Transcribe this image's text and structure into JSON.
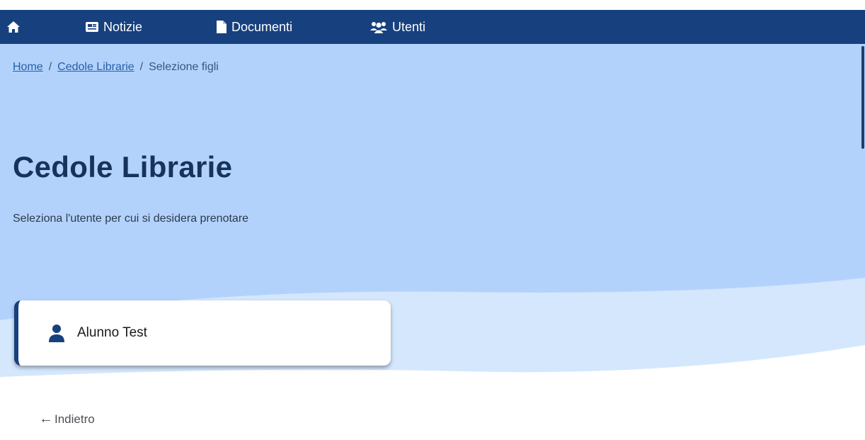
{
  "nav": {
    "home_icon": "home-icon",
    "items": [
      {
        "label": "Notizie",
        "icon": "newspaper-icon"
      },
      {
        "label": "Documenti",
        "icon": "document-icon"
      },
      {
        "label": "Utenti",
        "icon": "users-icon"
      }
    ]
  },
  "breadcrumb": {
    "home": "Home",
    "separator": "/",
    "section": "Cedole Librarie",
    "current": "Selezione figli"
  },
  "page": {
    "title": "Cedole Librarie",
    "subtitle": "Seleziona l'utente per cui si desidera prenotare"
  },
  "users": [
    {
      "name": "Alunno Test",
      "icon": "user-icon"
    }
  ],
  "back": {
    "arrow": "←",
    "label": "Indietro"
  },
  "colors": {
    "navbar": "#17407e",
    "hero": "#b3d2fb",
    "title": "#17335c"
  }
}
